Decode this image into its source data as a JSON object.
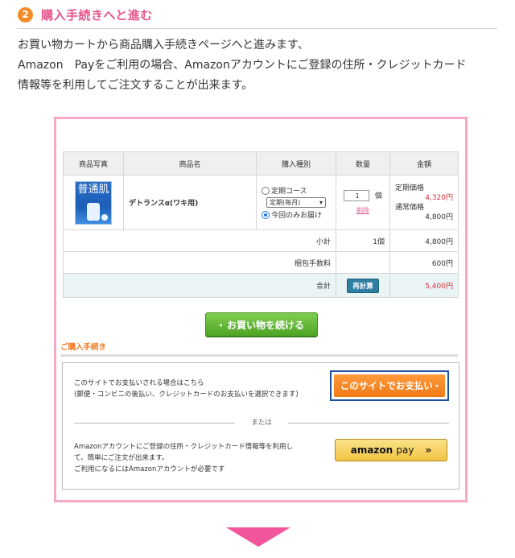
{
  "step": {
    "number": "2",
    "title": "購入手続きへと進む"
  },
  "description": [
    "お買い物カートから商品購入手続きページへと進みます、",
    "Amazon　Payをご利用の場合、Amazonアカウントにご登録の住所・クレジットカード",
    "情報等を利用してご注文することが出来ます。"
  ],
  "cart": {
    "headers": [
      "商品写真",
      "商品名",
      "購入種別",
      "数量",
      "金額"
    ],
    "product": {
      "image_text": "普通肌",
      "name": "デトランスα(ワキ用)",
      "option_subscription": "定期コース",
      "subscription_select": "定期(毎月)",
      "option_once": "今回のみお届け",
      "quantity": "1",
      "quantity_unit": "個",
      "delete_label": "削除",
      "subscription_price_label": "定期価格",
      "subscription_price": "4,320円",
      "regular_price_label": "通常価格",
      "regular_price": "4,800円"
    },
    "subtotal": {
      "label": "小計",
      "qty": "1個",
      "amount": "4,800円"
    },
    "packing": {
      "label": "梱包手数料",
      "amount": "600円"
    },
    "total": {
      "label": "合計",
      "recalc_label": "再計算",
      "amount": "5,400円"
    }
  },
  "continue_label": "お買い物を続ける",
  "checkout": {
    "section_title": "ご購入手続き",
    "site_text": [
      "このサイトでお支払いされる場合はこちら",
      "(郵便・コンビニの後払い、クレジットカードのお支払いを選択できます)"
    ],
    "site_pay_label": "このサイトでお支払い",
    "or_label": "または",
    "amazon_text": [
      "Amazonアカウントにご登録の住所・クレジットカード情報等を利用し",
      "て、簡単にご注文が出来ます。",
      "ご利用になるにはAmazonアカウントが必要です"
    ],
    "amazon_logo": "amazon",
    "amazon_pay": "pay",
    "amazon_chevrons": "»"
  },
  "colors": {
    "accent_pink": "#e8548c",
    "frame_border": "#f5a9c6",
    "step_orange": "#f28c2a",
    "price_red": "#d6323f",
    "continue_green": "#4ea424",
    "site_pay_orange": "#f07a16",
    "site_pay_border": "#1f4ea1",
    "amazon_yellow": "#f2c443",
    "arrow_pink": "#f2559b"
  }
}
